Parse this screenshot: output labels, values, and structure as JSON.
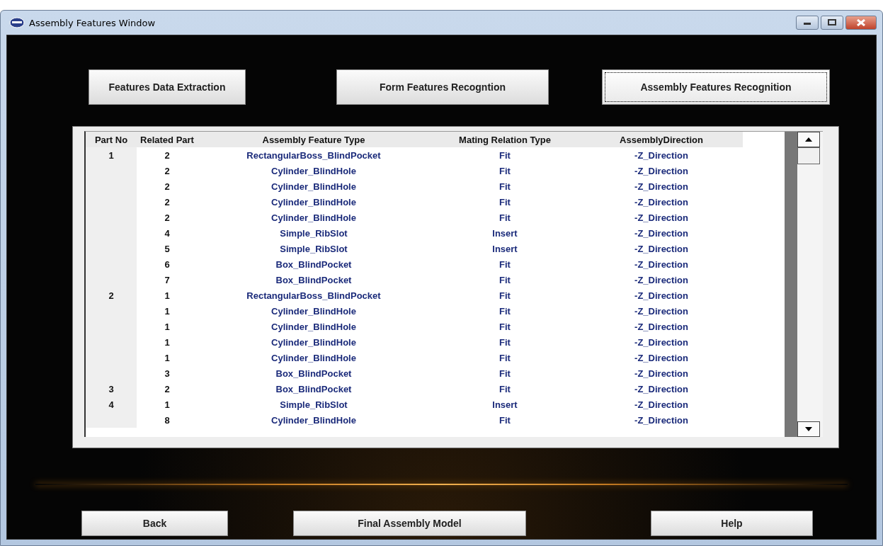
{
  "window": {
    "title": "Assembly Features Window"
  },
  "top_buttons": [
    {
      "label": "Features Data Extraction",
      "selected": false
    },
    {
      "label": "Form Features Recogntion",
      "selected": false
    },
    {
      "label": "Assembly Features Recognition",
      "selected": true
    }
  ],
  "table": {
    "columns": [
      "Part No",
      "Related Part",
      "Assembly Feature Type",
      "Mating Relation Type",
      "AssemblyDirection"
    ],
    "rows": [
      {
        "part_no": "1",
        "related_part": "2",
        "feature_type": "RectangularBoss_BlindPocket",
        "mating": "Fit",
        "direction": "-Z_Direction"
      },
      {
        "related_part": "2",
        "feature_type": "Cylinder_BlindHole",
        "mating": "Fit",
        "direction": "-Z_Direction"
      },
      {
        "related_part": "2",
        "feature_type": "Cylinder_BlindHole",
        "mating": "Fit",
        "direction": "-Z_Direction"
      },
      {
        "related_part": "2",
        "feature_type": "Cylinder_BlindHole",
        "mating": "Fit",
        "direction": "-Z_Direction"
      },
      {
        "related_part": "2",
        "feature_type": "Cylinder_BlindHole",
        "mating": "Fit",
        "direction": "-Z_Direction"
      },
      {
        "related_part": "4",
        "feature_type": "Simple_RibSlot",
        "mating": "Insert",
        "direction": "-Z_Direction"
      },
      {
        "related_part": "5",
        "feature_type": "Simple_RibSlot",
        "mating": "Insert",
        "direction": "-Z_Direction"
      },
      {
        "related_part": "6",
        "feature_type": "Box_BlindPocket",
        "mating": "Fit",
        "direction": "-Z_Direction"
      },
      {
        "related_part": "7",
        "feature_type": "Box_BlindPocket",
        "mating": "Fit",
        "direction": "-Z_Direction"
      },
      {
        "part_no": "2",
        "related_part": "1",
        "feature_type": "RectangularBoss_BlindPocket",
        "mating": "Fit",
        "direction": "-Z_Direction"
      },
      {
        "related_part": "1",
        "feature_type": "Cylinder_BlindHole",
        "mating": "Fit",
        "direction": "-Z_Direction"
      },
      {
        "related_part": "1",
        "feature_type": "Cylinder_BlindHole",
        "mating": "Fit",
        "direction": "-Z_Direction"
      },
      {
        "related_part": "1",
        "feature_type": "Cylinder_BlindHole",
        "mating": "Fit",
        "direction": "-Z_Direction"
      },
      {
        "related_part": "1",
        "feature_type": "Cylinder_BlindHole",
        "mating": "Fit",
        "direction": "-Z_Direction"
      },
      {
        "related_part": "3",
        "feature_type": "Box_BlindPocket",
        "mating": "Fit",
        "direction": "-Z_Direction"
      },
      {
        "part_no": "3",
        "related_part": "2",
        "feature_type": "Box_BlindPocket",
        "mating": "Fit",
        "direction": "-Z_Direction"
      },
      {
        "part_no": "4",
        "related_part": "1",
        "feature_type": "Simple_RibSlot",
        "mating": "Insert",
        "direction": "-Z_Direction"
      },
      {
        "related_part": "8",
        "feature_type": "Cylinder_BlindHole",
        "mating": "Fit",
        "direction": "-Z_Direction"
      }
    ]
  },
  "bottom_buttons": [
    "Back",
    "Final Assembly Model",
    "Help"
  ]
}
